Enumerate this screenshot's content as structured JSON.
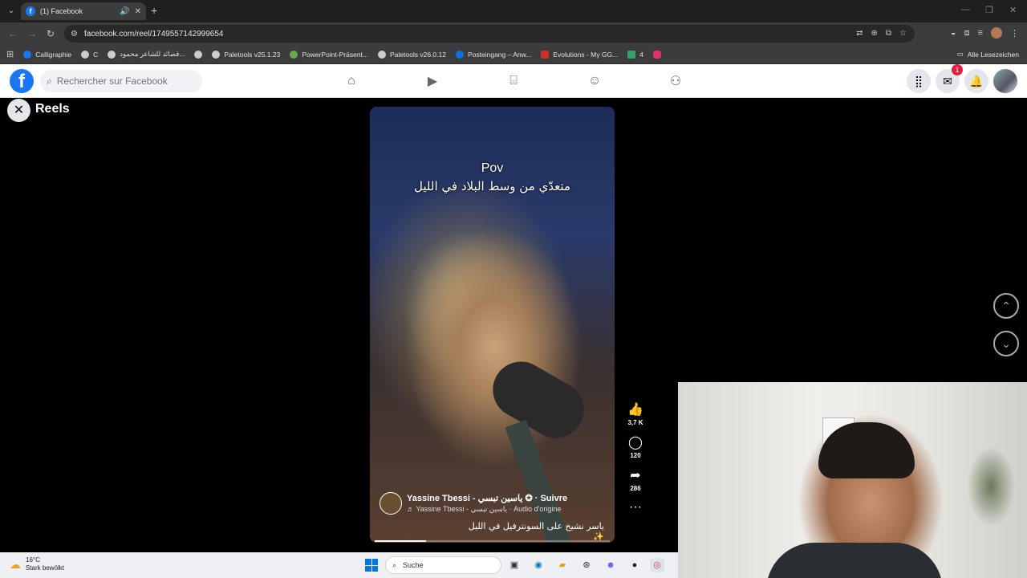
{
  "browser": {
    "tab_title": "(1) Facebook",
    "tab_favicon": "f",
    "url": "facebook.com/reel/1749557142999654",
    "bookmarks": [
      {
        "label": "Calligraphie",
        "color": "#1877f2"
      },
      {
        "label": "C",
        "color": "#cccccc"
      },
      {
        "label": "قصائد للشاعر محمود...",
        "color": "#cccccc"
      },
      {
        "label": "",
        "color": "#cccccc"
      },
      {
        "label": "Paletools v25.1.23",
        "color": "#cccccc"
      },
      {
        "label": "PowerPoint-Präsent...",
        "color": "#c43e1c"
      },
      {
        "label": "Paletools v26.0.12",
        "color": "#cccccc"
      },
      {
        "label": "Posteingang – Anw...",
        "color": "#0a74da"
      },
      {
        "label": "Evolutions - My GG...",
        "color": "#d0302a"
      },
      {
        "label": "4",
        "color": "#38a169"
      },
      {
        "label": "",
        "color": "#e1306c"
      }
    ],
    "all_bookmarks": "Alle Lesezeichen"
  },
  "facebook": {
    "search_placeholder": "Rechercher sur Facebook",
    "messenger_badge": "1",
    "reels_title": "Reels"
  },
  "reel": {
    "overlay_line1": "Pov",
    "overlay_line2": "متعدّي من وسط البلاد في الليل",
    "author": "Yassine Tbessi - ياسين تبسي",
    "follow": "Suivre",
    "audio": "♬ Yassine Tbessi - ياسين تبسي · Audio d'origine",
    "caption": "ياسر نشيخ على السونترفيل في الليل ✨",
    "likes": "3,7 K",
    "comments": "120",
    "shares": "286",
    "progress_percent": 22
  },
  "taskbar": {
    "temperature": "16°C",
    "weather_desc": "Stark bewölkt",
    "search_label": "Suche"
  }
}
